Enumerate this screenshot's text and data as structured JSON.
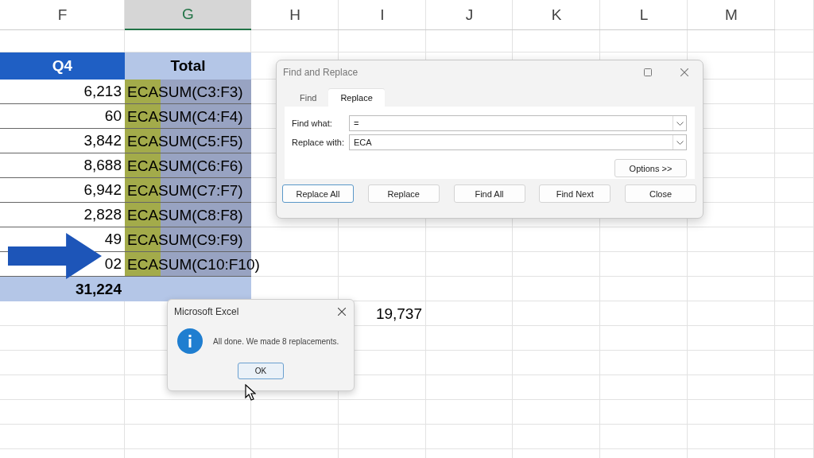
{
  "columns": [
    {
      "label": "F",
      "selected": false
    },
    {
      "label": "G",
      "selected": true
    },
    {
      "label": "H",
      "selected": false
    },
    {
      "label": "I",
      "selected": false
    },
    {
      "label": "J",
      "selected": false
    },
    {
      "label": "K",
      "selected": false
    },
    {
      "label": "L",
      "selected": false
    },
    {
      "label": "M",
      "selected": false
    }
  ],
  "table": {
    "header": [
      "Q4",
      "Total"
    ],
    "rows": [
      {
        "q4": "6,213",
        "total": "ECASUM(C3:F3)"
      },
      {
        "q4": "60",
        "total": "ECASUM(C4:F4)"
      },
      {
        "q4": "3,842",
        "total": "ECASUM(C5:F5)"
      },
      {
        "q4": "8,688",
        "total": "ECASUM(C6:F6)"
      },
      {
        "q4": "6,942",
        "total": "ECASUM(C7:F7)"
      },
      {
        "q4": "2,828",
        "total": "ECASUM(C8:F8)"
      },
      {
        "q4": "49",
        "total": "ECASUM(C9:F9)"
      },
      {
        "q4": "02",
        "total": "ECASUM(C10:F10)"
      }
    ],
    "total_row": {
      "q4": "31,224"
    }
  },
  "extra_value": "19,737",
  "find_replace": {
    "title": "Find and Replace",
    "tabs": [
      {
        "label": "Find",
        "selected": false
      },
      {
        "label": "Replace",
        "selected": true
      }
    ],
    "fields": [
      {
        "label": "Find what:",
        "value": "="
      },
      {
        "label": "Replace with:",
        "value": "ECA"
      }
    ],
    "options_button": "Options >>",
    "buttons": [
      {
        "label": "Replace All",
        "default": true
      },
      {
        "label": "Replace",
        "default": false
      },
      {
        "label": "Find All",
        "default": false
      },
      {
        "label": "Find Next",
        "default": false
      },
      {
        "label": "Close",
        "default": false
      }
    ]
  },
  "message": {
    "title": "Microsoft Excel",
    "text": "All done. We made 8 replacements.",
    "button": "OK"
  }
}
